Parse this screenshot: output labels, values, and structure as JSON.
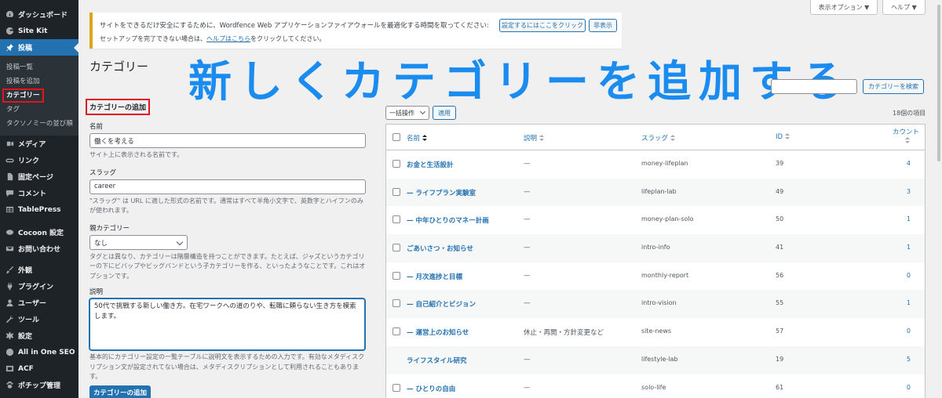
{
  "sidebar": {
    "items": [
      {
        "label": "ダッシュボード",
        "icon": "dashboard-icon"
      },
      {
        "label": "Site Kit",
        "icon": "sitekit-icon"
      },
      {
        "label": "投稿",
        "icon": "pin-icon",
        "active": true
      }
    ],
    "submenu": [
      {
        "label": "投稿一覧"
      },
      {
        "label": "投稿を追加"
      },
      {
        "label": "カテゴリー",
        "current": true
      },
      {
        "label": "タグ"
      },
      {
        "label": "タクソノミーの並び順"
      }
    ],
    "items_after": [
      {
        "label": "メディア",
        "icon": "media-icon"
      },
      {
        "label": "リンク",
        "icon": "link-icon"
      },
      {
        "label": "固定ページ",
        "icon": "page-icon"
      },
      {
        "label": "コメント",
        "icon": "comment-icon"
      },
      {
        "label": "TablePress",
        "icon": "table-icon"
      },
      {
        "label": "Cocoon 設定",
        "icon": "cocoon-icon"
      },
      {
        "label": "お問い合わせ",
        "icon": "mail-icon"
      },
      {
        "label": "外観",
        "icon": "brush-icon"
      },
      {
        "label": "プラグイン",
        "icon": "plugin-icon"
      },
      {
        "label": "ユーザー",
        "icon": "user-icon"
      },
      {
        "label": "ツール",
        "icon": "wrench-icon"
      },
      {
        "label": "設定",
        "icon": "settings-icon"
      },
      {
        "label": "All in One SEO",
        "icon": "seo-icon"
      },
      {
        "label": "ACF",
        "icon": "acf-icon"
      },
      {
        "label": "ポチップ管理",
        "icon": "paw-icon"
      }
    ]
  },
  "topbar": {
    "screen_options": "表示オプション ▼",
    "help": "ヘルプ ▼"
  },
  "notice": {
    "line1": "サイトをできるだけ安全にするために、Wordfence Web アプリケーションファイアウォールを最適化する時間を取ってください:",
    "button1": "設定するにはここをクリック",
    "button2": "非表示",
    "line2_pre": "セットアップを完了できない場合は、",
    "line2_link": "ヘルプはこちら",
    "line2_post": "をクリックしてください。"
  },
  "page": {
    "title": "カテゴリー",
    "overlay_title": "新しくカテゴリーを追加する",
    "search_placeholder": "",
    "search_button": "カテゴリーを検索"
  },
  "form": {
    "heading": "カテゴリーの追加",
    "name_label": "名前",
    "name_value": "働くを考える",
    "name_help": "サイト上に表示される名前です。",
    "slug_label": "スラッグ",
    "slug_value": "career",
    "slug_help": "\"スラッグ\" は URL に適した形式の名前です。通常はすべて半角小文字で、英数字とハイフンのみが使われます。",
    "parent_label": "親カテゴリー",
    "parent_value": "なし",
    "parent_help": "タグとは異なり、カテゴリーは階層構造を持つことができます。たとえば、ジャズというカテゴリーの下にビバップやビッグバンドという子カテゴリーを作る、といったようなことです。これはオプションです。",
    "desc_label": "説明",
    "desc_value": "50代で挑戦する新しい働き方。在宅ワークへの道のりや、転職に頼らない生き方を模索します。",
    "desc_help": "基本的にカテゴリー設定の一覧テーブルに説明文を表示するための入力です。有効なメタディスクリプション文が設定されてない場合は、メタディスクリプションとして利用されることもあります。",
    "submit": "カテゴリーの追加"
  },
  "table_controls": {
    "bulk_action": "一括操作",
    "apply": "適用",
    "count": "18個の項目"
  },
  "table": {
    "columns": {
      "name": "名前",
      "desc": "説明",
      "slug": "スラッグ",
      "id": "ID",
      "count": "カウント"
    },
    "rows": [
      {
        "name": "お金と生活設計",
        "desc": "—",
        "slug": "money-lifeplan",
        "id": "39",
        "count": "4",
        "has_cb": true
      },
      {
        "name": "— ライフプラン実験室",
        "desc": "—",
        "slug": "lifeplan-lab",
        "id": "49",
        "count": "3",
        "has_cb": true
      },
      {
        "name": "— 中年ひとりのマネー計画",
        "desc": "—",
        "slug": "money-plan-solo",
        "id": "50",
        "count": "1",
        "has_cb": true
      },
      {
        "name": "ごあいさつ・お知らせ",
        "desc": "—",
        "slug": "intro-info",
        "id": "41",
        "count": "1",
        "has_cb": true
      },
      {
        "name": "— 月次進捗と目標",
        "desc": "—",
        "slug": "monthly-report",
        "id": "56",
        "count": "0",
        "has_cb": true
      },
      {
        "name": "— 自己紹介とビジョン",
        "desc": "—",
        "slug": "intro-vision",
        "id": "55",
        "count": "1",
        "has_cb": true
      },
      {
        "name": "— 運営上のお知らせ",
        "desc": "休止・再開・方針変更など",
        "slug": "site-news",
        "id": "57",
        "count": "0",
        "has_cb": true
      },
      {
        "name": "ライフスタイル研究",
        "desc": "—",
        "slug": "lifestyle-lab",
        "id": "19",
        "count": "5",
        "has_cb": false
      },
      {
        "name": "— ひとりの自由",
        "desc": "—",
        "slug": "solo-life",
        "id": "61",
        "count": "0",
        "has_cb": true
      }
    ]
  },
  "colors": {
    "sidebar_bg": "#1d2327",
    "accent": "#2271b1",
    "highlight_box": "#e0151f",
    "overlay_text": "#1a8cf0",
    "notice_border": "#dba617"
  }
}
